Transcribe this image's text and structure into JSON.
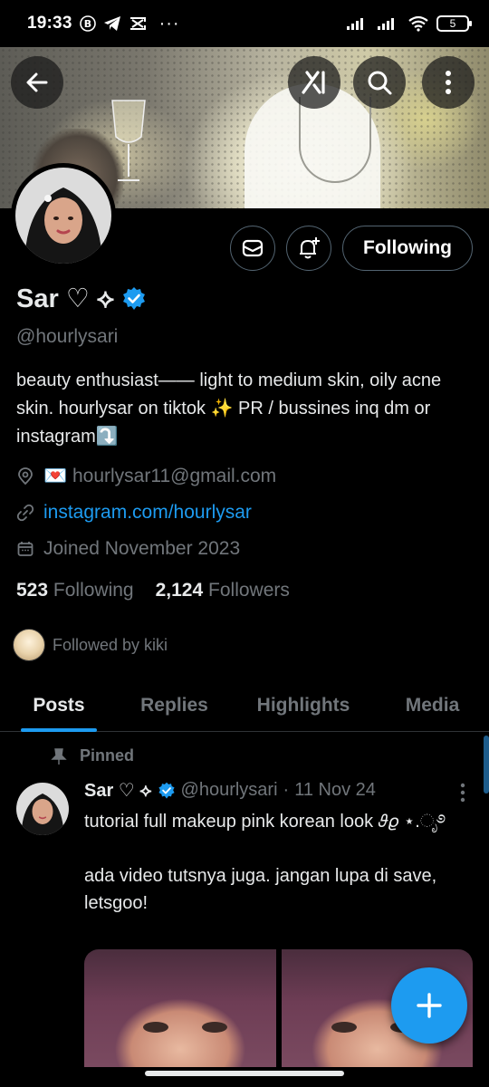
{
  "status_bar": {
    "time": "19:33",
    "battery": "5",
    "more_dots": "···"
  },
  "profile": {
    "display_name": "Sar ♡ ⟡",
    "handle": "@hourlysari",
    "bio": "beauty enthusiast—— light to medium skin, oily acne skin. hourlysar on tiktok ✨ PR / bussines inq dm or instagram⤵️",
    "location": "💌 hourlysar11@gmail.com",
    "website": "instagram.com/hourlysar",
    "joined": "Joined November 2023",
    "following_count": "523",
    "following_label": "Following",
    "followers_count": "2,124",
    "followers_label": "Followers",
    "followed_by": "Followed by kiki",
    "follow_button_label": "Following"
  },
  "tabs": [
    {
      "label": "Posts",
      "active": true
    },
    {
      "label": "Replies",
      "active": false
    },
    {
      "label": "Highlights",
      "active": false
    },
    {
      "label": "Media",
      "active": false
    }
  ],
  "post": {
    "pinned_label": "Pinned",
    "author_name": "Sar ♡ ⟡",
    "author_handle": "@hourlysari",
    "separator": "·",
    "date": "11 Nov 24",
    "text": "tutorial full makeup pink korean look  𝜗𝜚 ⋆.ೃ࿔\n\nada video tutsnya juga. jangan lupa di save, letsgoo!"
  },
  "colors": {
    "accent": "#1d9bf0",
    "verified": "#1d9bf0",
    "muted": "#71767b",
    "text": "#e7e9ea",
    "background": "#000000"
  },
  "icons": {
    "back": "arrow-left-icon",
    "grok": "grok-icon",
    "search": "search-icon",
    "more": "more-vertical-icon",
    "message": "envelope-icon",
    "notify": "bell-plus-icon",
    "verified": "verified-badge-icon",
    "location": "location-pin-icon",
    "link": "link-icon",
    "calendar": "calendar-icon",
    "pin": "pin-icon",
    "compose": "plus-icon"
  }
}
